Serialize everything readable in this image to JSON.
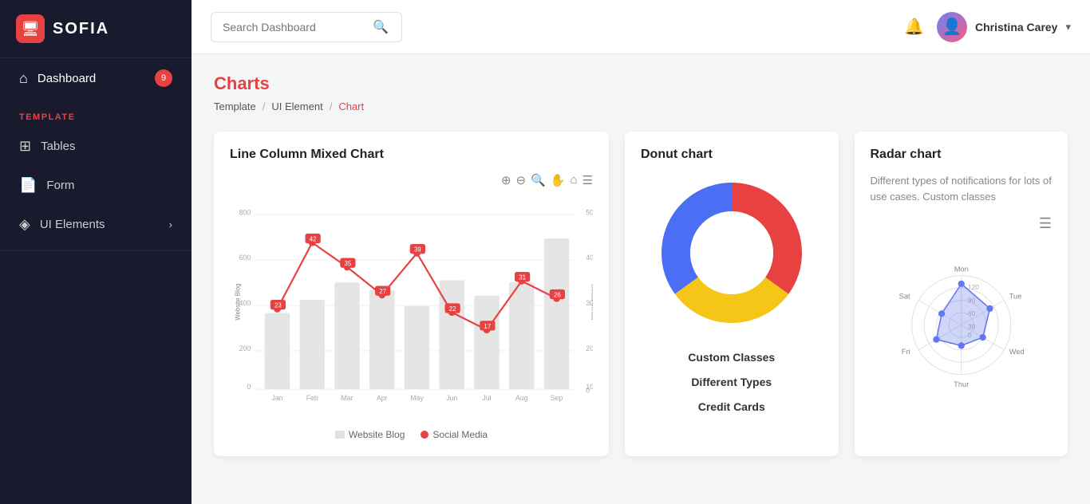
{
  "app": {
    "logo_icon": "🖥",
    "logo_text": "SOFIA"
  },
  "sidebar": {
    "nav_items": [
      {
        "id": "dashboard",
        "label": "Dashboard",
        "icon": "⌂",
        "badge": "9",
        "active": true
      },
      {
        "id": "tables",
        "label": "Tables",
        "icon": "⊞",
        "section": "TEMPLATE"
      },
      {
        "id": "form",
        "label": "Form",
        "icon": "📄"
      },
      {
        "id": "ui-elements",
        "label": "UI Elements",
        "icon": "◈",
        "chevron": "›"
      }
    ],
    "section_label": "TEMPLATE"
  },
  "header": {
    "search_placeholder": "Search Dashboard",
    "user_name": "Christina Carey",
    "bell_icon": "🔔",
    "chevron_icon": "▾"
  },
  "breadcrumb": {
    "items": [
      "Template",
      "UI Element",
      "Chart"
    ],
    "active_index": 2
  },
  "page": {
    "title": "Charts"
  },
  "charts": {
    "mixed": {
      "title": "Line Column Mixed Chart",
      "y_left_label": "Website Blog",
      "y_right_label": "Social Media",
      "months": [
        "Jan",
        "Feb",
        "Mar",
        "Apr",
        "May",
        "Jun",
        "Jul",
        "Aug",
        "Sep"
      ],
      "bar_values": [
        350,
        410,
        490,
        455,
        380,
        500,
        430,
        490,
        690
      ],
      "line_values": [
        23,
        42,
        35,
        27,
        39,
        22,
        17,
        31,
        26
      ],
      "bar_color": "#e0e0e0",
      "line_color": "#e84141",
      "legend": {
        "bar_label": "Website Blog",
        "line_label": "Social Media"
      }
    },
    "donut": {
      "title": "Donut chart",
      "segments": [
        {
          "label": "Custom Classes",
          "color": "#e84141",
          "value": 35
        },
        {
          "label": "Different Types",
          "color": "#f5c518",
          "value": 30
        },
        {
          "label": "Credit Cards",
          "color": "#4c6ef5",
          "value": 35
        }
      ],
      "legend_items": [
        "Custom Classes",
        "Different Types",
        "Credit Cards"
      ]
    },
    "radar": {
      "title": "Radar chart",
      "subtitle": "Different types of notifications for lots of use cases. Custom classes",
      "labels": [
        "Mon",
        "Tue",
        "Wed",
        "Thur",
        "Fri",
        "Sat"
      ],
      "rings": [
        0,
        30,
        60,
        90,
        120
      ],
      "data": [
        100,
        80,
        60,
        50,
        70,
        55
      ]
    }
  }
}
